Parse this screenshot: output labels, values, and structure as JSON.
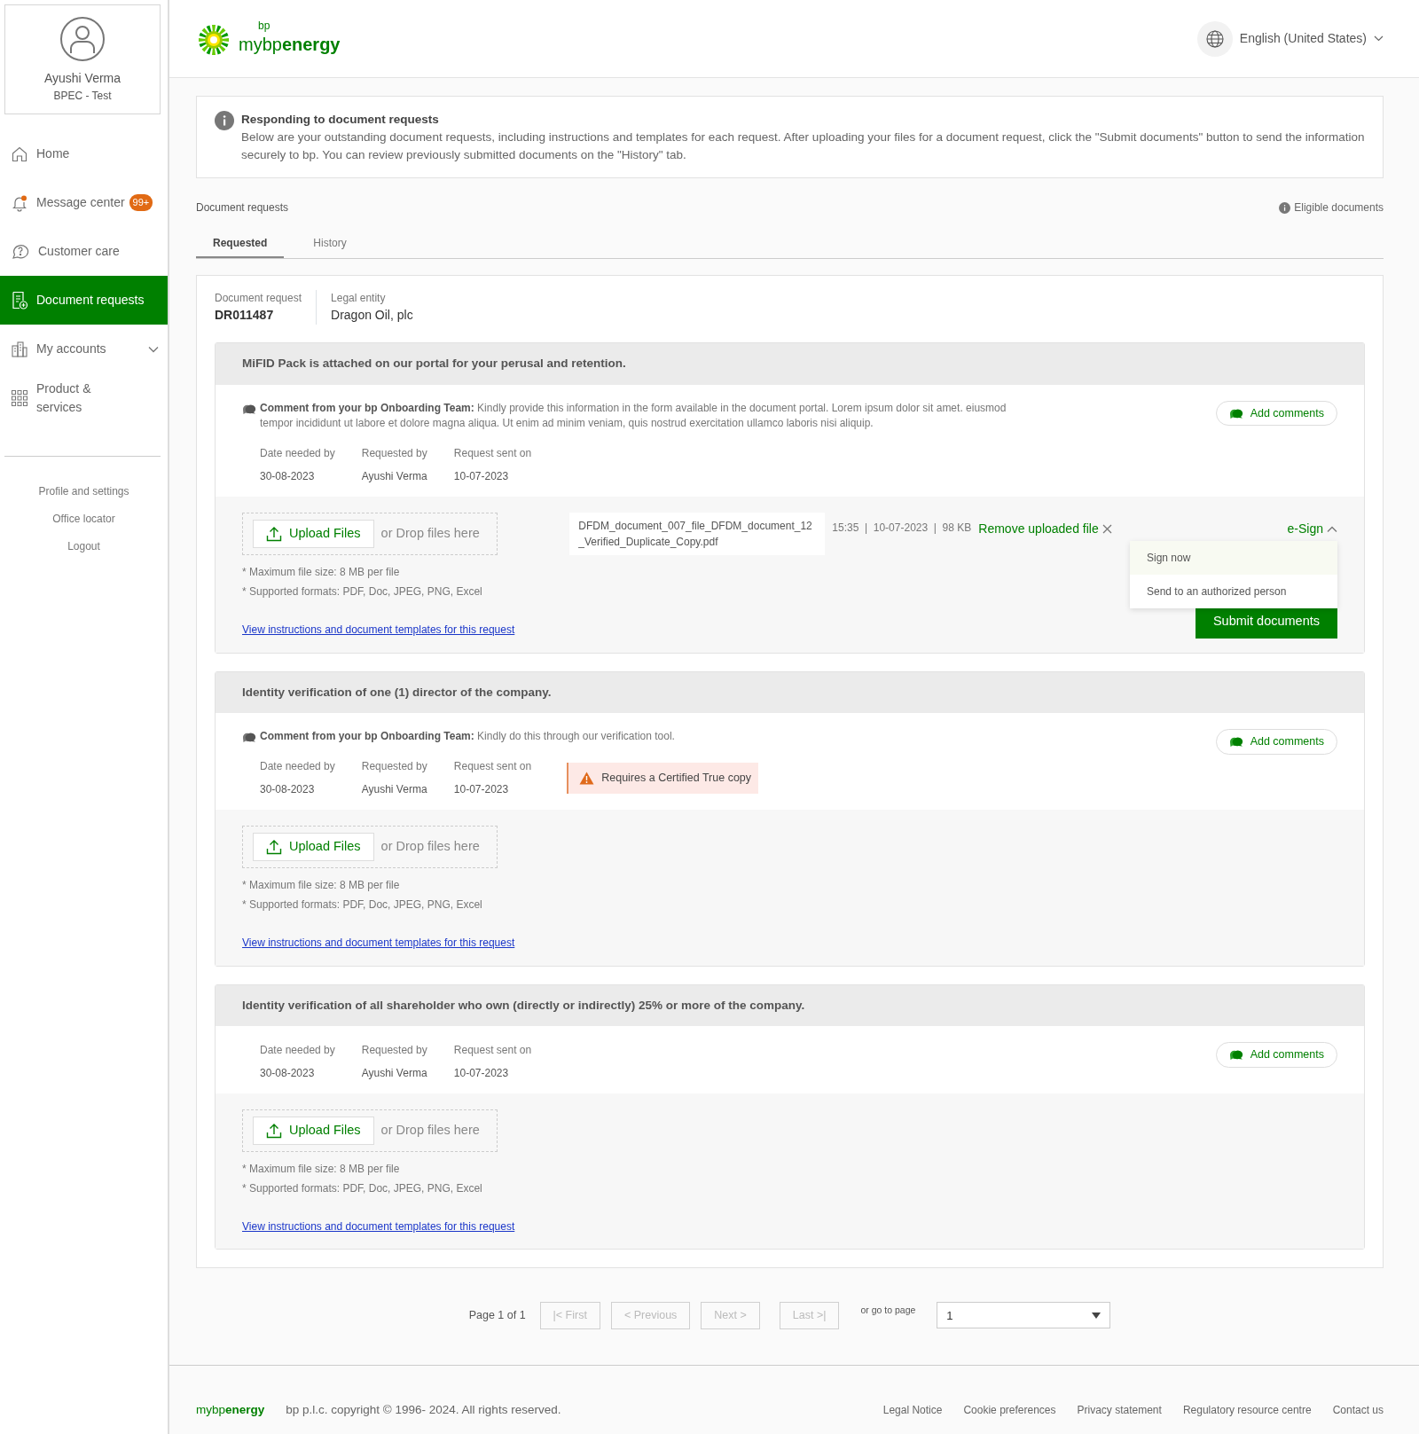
{
  "user": {
    "name": "Ayushi Verma",
    "org": "BPEC - Test"
  },
  "nav": [
    {
      "label": "Home",
      "kind": "home",
      "selected": false
    },
    {
      "label": "Message center",
      "kind": "bell",
      "badge": "99+",
      "selected": false
    },
    {
      "label": "Customer care",
      "kind": "help",
      "selected": false
    },
    {
      "label": "Document requests",
      "kind": "document",
      "selected": true
    },
    {
      "label": "My accounts",
      "kind": "building",
      "expandable": true,
      "selected": false
    },
    {
      "label": "Product & services",
      "kind": "grid",
      "selected": false
    }
  ],
  "sidebar_links": [
    "Profile and settings",
    "Office locator",
    "Logout"
  ],
  "header": {
    "logo_mark": "bp",
    "logo_text": "mybp**energy**",
    "language": "English (United States)"
  },
  "info": {
    "title": "Responding to document requests",
    "text": "Below are your outstanding document requests, including instructions and templates for each request. After uploading your files for a document request, click the \"Submit documents\" button to send the information securely to bp. You can review previously submitted documents on the \"History\" tab."
  },
  "section_title": "Document requests",
  "eligible": "Eligible documents",
  "tabs": [
    {
      "label": "Requested",
      "selected": true
    },
    {
      "label": "History",
      "selected": false
    }
  ],
  "request": {
    "id_label": "Document request",
    "id": "DR011487",
    "entity_label": "Legal entity",
    "entity": "Dragon Oil, plc"
  },
  "items": [
    {
      "title": "MiFID Pack is attached on our portal for your perusal and retention.",
      "comment": "**Comment from your bp Onboarding Team:** Kindly provide this information in the form available in the document portal. Lorem ipsum dolor sit amet. eiusmod tempor incididunt ut labore et dolore magna aliqua. Ut enim ad minim veniam, quis nostrud exercitation ullamco laboris nisi aliquip.",
      "add_comments": "Add comments",
      "meta": [
        {
          "label": "Date needed by",
          "value": "30-08-2023"
        },
        {
          "label": "Requested by",
          "value": "Ayushi Verma"
        },
        {
          "label": "Request sent on",
          "value": "10-07-2023"
        }
      ],
      "upload": "Upload Files",
      "drop": "or Drop files here",
      "notes": [
        "* Maximum file size: 8 MB per file",
        "* Supported formats: PDF, Doc, JPEG, PNG, Excel"
      ],
      "file": {
        "name": "DFDM_document_007_file_DFDM_document_12_Verified_Duplicate_Copy.pdf",
        "details": "15:35  |  10-07-2023  |  98 KB",
        "remove": "Remove uploaded file"
      },
      "esign": {
        "label": "e-Sign",
        "expanded": true,
        "menu": [
          {
            "label": "Sign now",
            "selected": true
          },
          {
            "label": "Send to an authorized person",
            "selected": false
          }
        ]
      },
      "submit": "Submit documents",
      "link": "View instructions and document templates for this request"
    },
    {
      "title": "Identity verification of one (1) director of the company.",
      "comment": "**Comment from your bp Onboarding Team:** Kindly do this through our verification tool.",
      "add_comments": "Add comments",
      "meta": [
        {
          "label": "Date needed by",
          "value": "30-08-2023"
        },
        {
          "label": "Requested by",
          "value": "Ayushi Verma"
        },
        {
          "label": "Request sent on",
          "value": "10-07-2023"
        }
      ],
      "warning": "Requires a Certified True copy",
      "upload": "Upload Files",
      "drop": "or Drop files here",
      "notes": [
        "* Maximum file size: 8 MB per file",
        "* Supported formats: PDF, Doc, JPEG, PNG, Excel"
      ],
      "link": "View instructions and document templates for this request"
    },
    {
      "title": "Identity verification of all shareholder who own (directly or indirectly) 25% or more of the company.",
      "add_comments": "Add comments",
      "meta": [
        {
          "label": "Date needed by",
          "value": "30-08-2023"
        },
        {
          "label": "Requested by",
          "value": "Ayushi Verma"
        },
        {
          "label": "Request sent on",
          "value": "10-07-2023"
        }
      ],
      "upload": "Upload Files",
      "drop": "or Drop files here",
      "notes": [
        "* Maximum file size: 8 MB per file",
        "* Supported formats: PDF, Doc, JPEG, PNG, Excel"
      ],
      "link": "View instructions and document templates for this request"
    }
  ],
  "pagination": {
    "page_text": "Page 1 of 1",
    "buttons": [
      {
        "label": "|< First",
        "disabled": true
      },
      {
        "label": "< Previous",
        "disabled": true
      },
      {
        "label": "Next >",
        "disabled": true
      },
      {
        "label": "Last >|",
        "disabled": true
      }
    ],
    "goto_label": "or go to page",
    "page_value": "1"
  },
  "footer": {
    "logo_text": "mybp**energy**",
    "copyright": "bp p.l.c. copyright © 1996- 2024. All rights reserved.",
    "links": [
      "Legal Notice",
      "Cookie preferences",
      "Privacy statement",
      "Regulatory resource centre",
      "Contact us"
    ]
  }
}
